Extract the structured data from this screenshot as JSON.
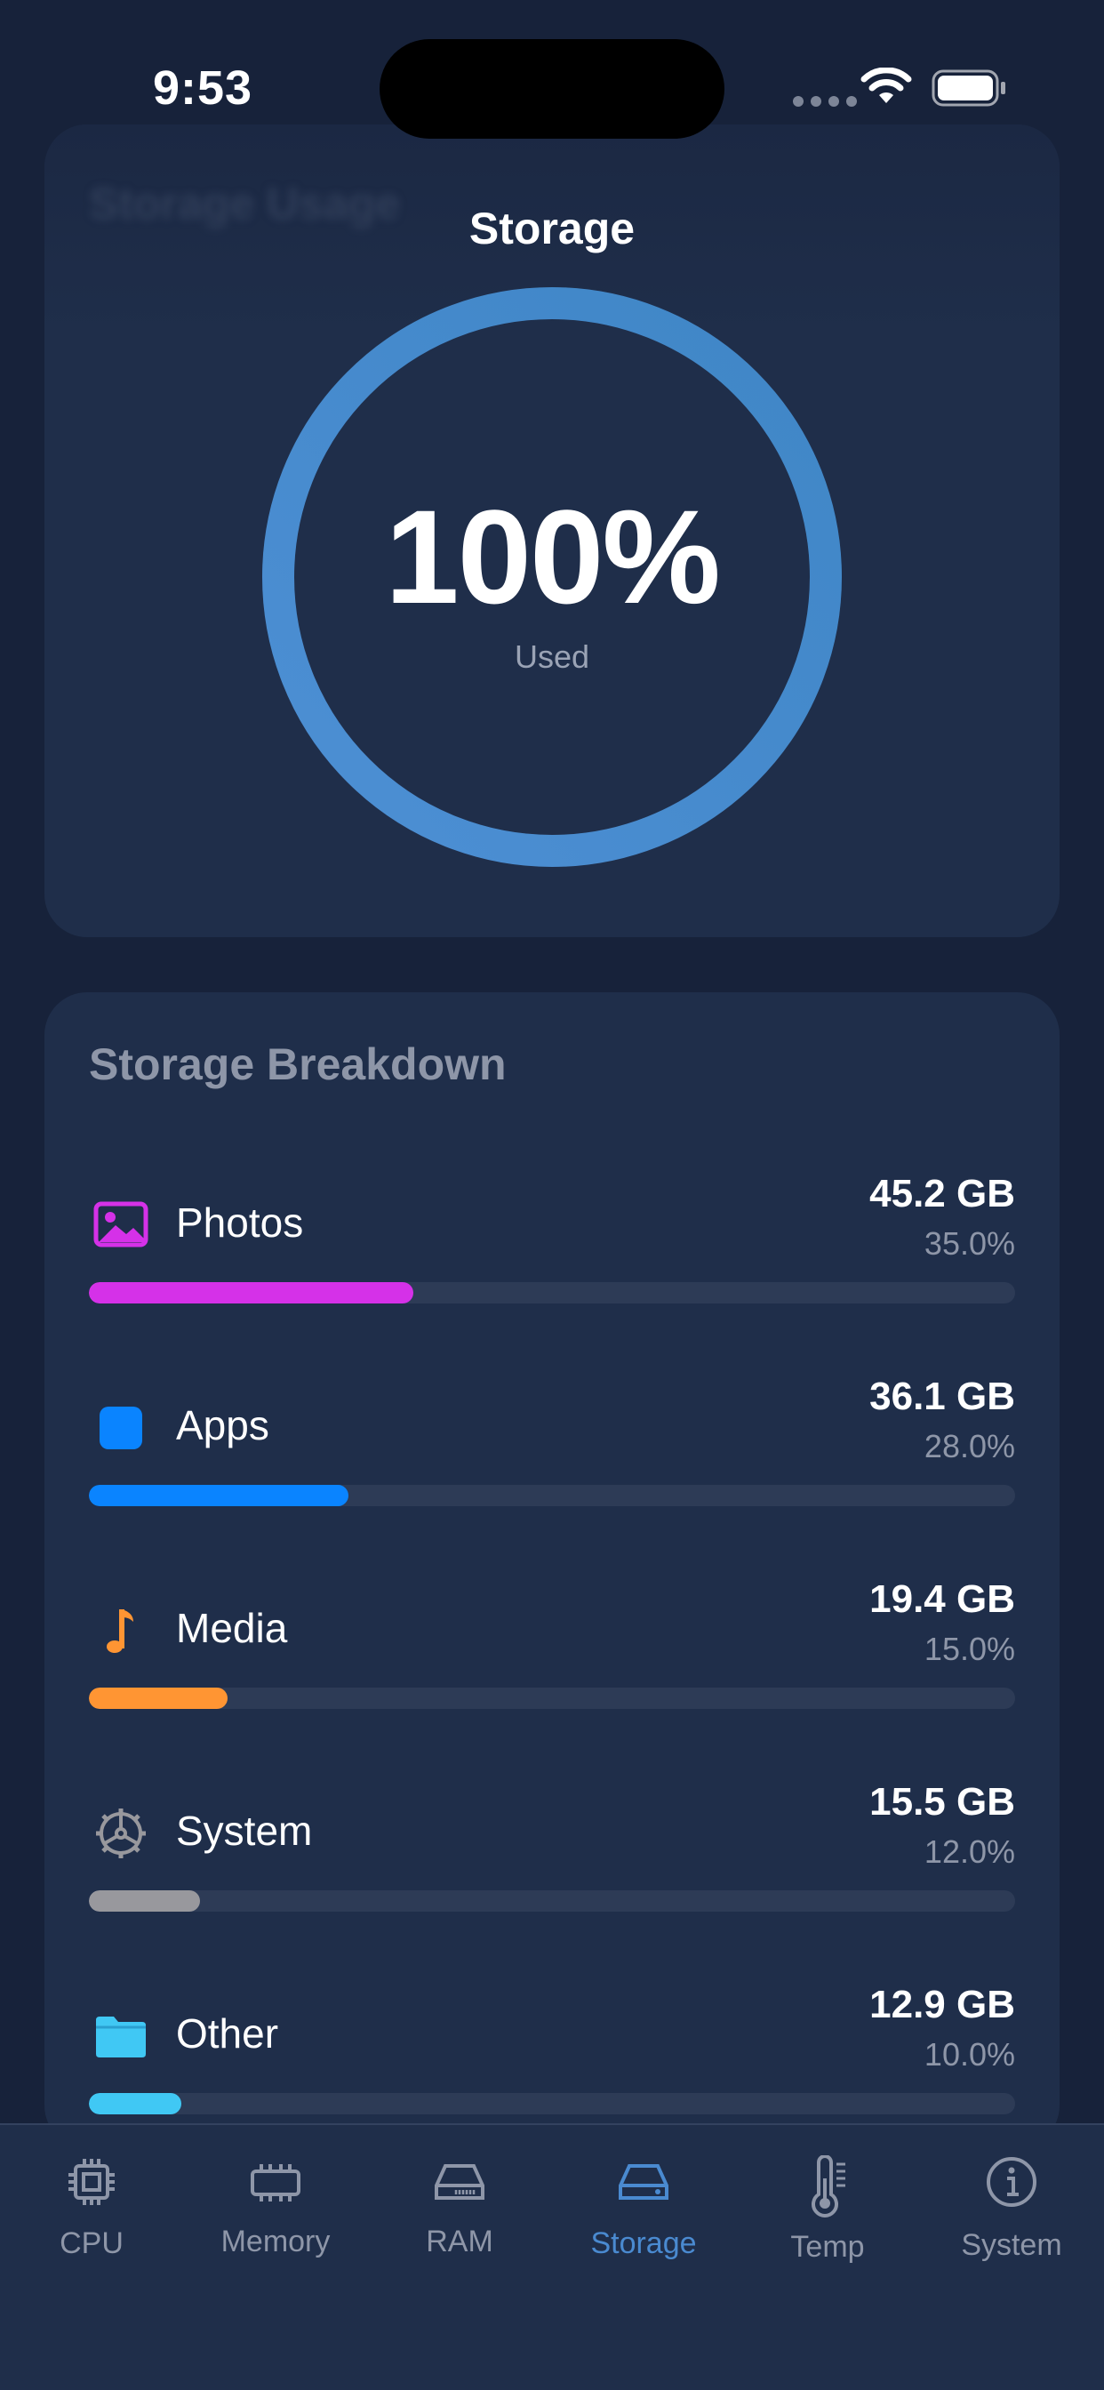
{
  "status_bar": {
    "time": "9:53"
  },
  "usage_card": {
    "title": "Storage Usage",
    "nav_title": "Storage",
    "gauge": {
      "value_text": "100%",
      "label": "Used",
      "fraction": 1.0,
      "color": "#4a8ad0"
    }
  },
  "breakdown": {
    "title": "Storage Breakdown",
    "items": [
      {
        "label": "Photos",
        "size": "45.2 GB",
        "percent": "35.0%",
        "fraction": 0.35,
        "color": "#d531e8",
        "icon": "photo-icon"
      },
      {
        "label": "Apps",
        "size": "36.1 GB",
        "percent": "28.0%",
        "fraction": 0.28,
        "color": "#0a84ff",
        "icon": "app-square-icon"
      },
      {
        "label": "Media",
        "size": "19.4 GB",
        "percent": "15.0%",
        "fraction": 0.15,
        "color": "#ff9533",
        "icon": "music-note-icon"
      },
      {
        "label": "System",
        "size": "15.5 GB",
        "percent": "12.0%",
        "fraction": 0.12,
        "color": "#98989d",
        "icon": "gear-icon"
      },
      {
        "label": "Other",
        "size": "12.9 GB",
        "percent": "10.0%",
        "fraction": 0.1,
        "color": "#40c8f4",
        "icon": "folder-icon"
      }
    ]
  },
  "tabs": [
    {
      "label": "CPU",
      "icon": "cpu-icon",
      "active": false
    },
    {
      "label": "Memory",
      "icon": "memory-icon",
      "active": false
    },
    {
      "label": "RAM",
      "icon": "ram-icon",
      "active": false
    },
    {
      "label": "Storage",
      "icon": "storage-drive-icon",
      "active": true
    },
    {
      "label": "Temp",
      "icon": "thermometer-icon",
      "active": false
    },
    {
      "label": "System",
      "icon": "info-icon",
      "active": false
    }
  ],
  "colors": {
    "background": "#17223a",
    "card": "#1f2e4a",
    "accent": "#4a8ad0",
    "muted_text": "#8e96a8"
  }
}
